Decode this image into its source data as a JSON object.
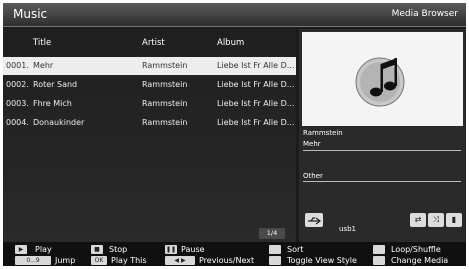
{
  "header": {
    "title": "Music",
    "section": "Media Browser"
  },
  "columns": {
    "title": "Title",
    "artist": "Artist",
    "album": "Album"
  },
  "tracks": [
    {
      "index": "0001.",
      "title": "Mehr",
      "artist": "Rammstein",
      "album": "Liebe Ist Fr Alle D..."
    },
    {
      "index": "0002.",
      "title": "Roter Sand",
      "artist": "Rammstein",
      "album": "Liebe Ist Fr Alle D..."
    },
    {
      "index": "0003.",
      "title": "Fhre Mich",
      "artist": "Rammstein",
      "album": "Liebe Ist Fr Alle D..."
    },
    {
      "index": "0004.",
      "title": "Donaukinder",
      "artist": "Rammstein",
      "album": "Liebe Ist Fr Alle D..."
    }
  ],
  "pager": "1/4",
  "info": {
    "artist": "Rammstein",
    "song": "Mehr",
    "other_label": "Other",
    "device": "usb1"
  },
  "footer": {
    "play": "Play",
    "stop": "Stop",
    "pause": "Pause",
    "sort": "Sort",
    "loop_shuffle": "Loop/Shuffle",
    "jump_key": "0...9",
    "jump": "Jump",
    "ok_key": "OK",
    "play_this": "Play This",
    "prev_next": "Previous/Next",
    "toggle_view": "Toggle View Style",
    "change_media": "Change Media"
  },
  "icons": [
    "music-note-icon",
    "usb-icon",
    "repeat-icon",
    "shuffle-icon",
    "stop-square-icon",
    "play-icon",
    "stop-icon",
    "pause-icon",
    "sort-icon",
    "loop-shuffle-icon"
  ]
}
